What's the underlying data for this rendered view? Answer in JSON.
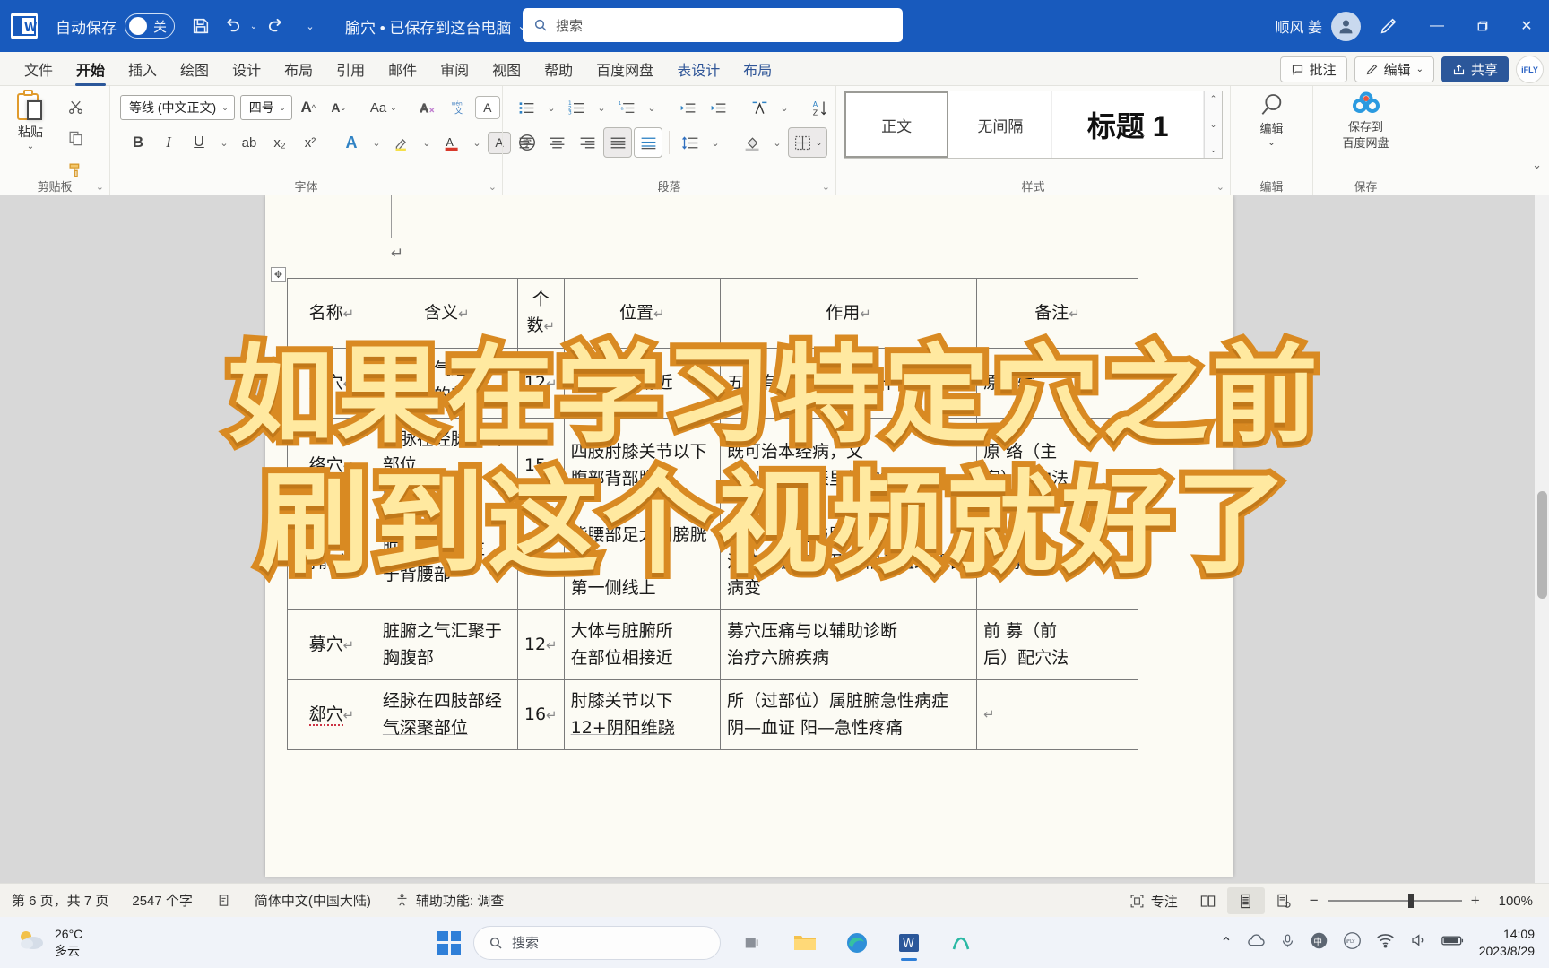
{
  "titlebar": {
    "app_icon": "word-icon",
    "autosave_label": "自动保存",
    "autosave_state": "关",
    "save_icon": "save-icon",
    "undo_icon": "undo-icon",
    "redo_icon": "redo-icon",
    "more_icon": "chevron-down-icon",
    "doc_title": "腧穴 • 已保存到这台电脑",
    "doc_title_caret": "⌄",
    "search_placeholder": "搜索",
    "search_icon": "search-icon",
    "user_name": "顺风 姜",
    "avatar_icon": "person-icon",
    "pen_icon": "pen-icon",
    "minimize": "—",
    "restore": "▢",
    "close": "✕",
    "bg_color": "#185abd"
  },
  "ribbon": {
    "tabs": [
      {
        "label": "文件",
        "state": "normal"
      },
      {
        "label": "开始",
        "state": "active"
      },
      {
        "label": "插入",
        "state": "normal"
      },
      {
        "label": "绘图",
        "state": "normal"
      },
      {
        "label": "设计",
        "state": "normal"
      },
      {
        "label": "布局",
        "state": "normal"
      },
      {
        "label": "引用",
        "state": "normal"
      },
      {
        "label": "邮件",
        "state": "normal"
      },
      {
        "label": "审阅",
        "state": "normal"
      },
      {
        "label": "视图",
        "state": "normal"
      },
      {
        "label": "帮助",
        "state": "normal"
      },
      {
        "label": "百度网盘",
        "state": "normal"
      },
      {
        "label": "表设计",
        "state": "contextual"
      },
      {
        "label": "布局",
        "state": "contextual"
      }
    ],
    "right_buttons": {
      "comment_label": "批注",
      "comment_icon": "comment-icon",
      "edit_label": "编辑",
      "edit_icon": "pencil-icon",
      "edit_caret": "⌄",
      "share_label": "共享",
      "share_icon": "share-icon",
      "ifly_label": "iFLY"
    },
    "groups": {
      "clipboard": {
        "label": "剪贴板",
        "paste_label": "粘贴",
        "paste_caret": "⌄",
        "cut_icon": "scissors-icon",
        "copy_icon": "copy-icon",
        "format_painter_icon": "format-painter-icon",
        "dialog_launcher": "⌄"
      },
      "font": {
        "label": "字体",
        "font_name": "等线 (中文正文)",
        "font_size": "四号",
        "grow_font_icon": "grow-font-icon",
        "shrink_font_icon": "shrink-font-icon",
        "change_case_label": "Aa",
        "clear_format_icon": "clear-formatting-icon",
        "phonetic_icon": "phonetic-guide-icon",
        "char_border_icon": "character-border-icon",
        "bold": "B",
        "italic": "I",
        "underline": "U",
        "strikethrough_icon": "strikethrough-icon",
        "subscript": "x₂",
        "superscript": "x²",
        "text_effects_icon": "text-effects-icon",
        "highlight_icon": "highlight-icon",
        "font_color_icon": "font-color-icon",
        "char_shading_icon": "character-shading-icon",
        "enclose_char_icon": "enclose-character-icon",
        "dialog_launcher": "⌄"
      },
      "paragraph": {
        "label": "段落",
        "bullets_icon": "bullet-list-icon",
        "numbering_icon": "numbered-list-icon",
        "multilevel_icon": "multilevel-list-icon",
        "decrease_indent_icon": "decrease-indent-icon",
        "increase_indent_icon": "increase-indent-icon",
        "cjk_layout_icon": "asian-layout-icon",
        "sort_icon": "sort-icon",
        "show_marks_icon": "show-formatting-marks-icon",
        "align_left_icon": "align-left-icon",
        "align_center_icon": "align-center-icon",
        "align_right_icon": "align-right-icon",
        "justify_icon": "justify-icon",
        "distribute_icon": "distribute-icon",
        "line_spacing_icon": "line-spacing-icon",
        "shading_icon": "shading-icon",
        "borders_icon": "borders-icon",
        "dialog_launcher": "⌄"
      },
      "styles": {
        "label": "样式",
        "items": [
          {
            "name": "正文",
            "selected": true
          },
          {
            "name": "无间隔",
            "selected": false
          },
          {
            "name": "标题 1",
            "selected": false
          }
        ],
        "scroll_up": "⌃",
        "scroll_down": "⌄",
        "more": "⌄",
        "dialog_launcher": "⌄"
      },
      "editing": {
        "label": "编辑",
        "find_icon": "search-icon",
        "editing_label": "编辑",
        "caret": "⌄"
      },
      "save": {
        "label": "保存",
        "baidu_label": "保存到\n百度网盘",
        "baidu_line1": "保存到",
        "baidu_line2": "百度网盘",
        "baidu_icon": "baidu-netdisk-icon"
      }
    },
    "collapse_icon": "⌄"
  },
  "document": {
    "table": {
      "headers": [
        "名称",
        "含义",
        "个\n数",
        "位置",
        "作用",
        "备注"
      ],
      "header_cells": [
        {
          "text": "名称",
          "mark": "↵"
        },
        {
          "text": "含义",
          "mark": "↵"
        },
        {
          "text": "个",
          "text2": "数",
          "mark": "↵"
        },
        {
          "text": "位置",
          "mark": "↵"
        },
        {
          "text": "作用",
          "mark": "↵"
        },
        {
          "text": "备注",
          "mark": "↵"
        }
      ],
      "rows": [
        {
          "name": "原穴",
          "meaning_l1": "脏腑原气经过",
          "meaning_l2": "和留止的部位",
          "count": "12",
          "location_l1": "腕踝关节附近",
          "location_l2": "",
          "effect_l1": "五脏有疾也，当取之十二原",
          "effect_l2": "",
          "note_l1": "原一输",
          "note_l2": ""
        },
        {
          "name": "络穴",
          "meaning_l1": "络脉在经脉分出部位",
          "meaning_l2": "的部位",
          "count": "15",
          "location_l1": "四肢肘膝关节以下",
          "location_l2": "腹部背部胸胁",
          "effect_l1": "既可治本经病，又",
          "effect_l2": "可以治疗相表里经的病症",
          "note_l1": "原 络（主",
          "note_l2": "客）配穴法"
        },
        {
          "name": "背俞穴",
          "meaning_l1": "脏腑之气输注",
          "meaning_l2": "于背腰部",
          "count": "12",
          "location_l1": "背腰部足太阳膀胱经",
          "location_l2": "第一侧线上",
          "effect_l1": "背俞穴压痛与脏腑病有关",
          "effect_l2": "治疗五脏疾病及其相关组织器官病变",
          "note_l1": "俞 募配穴法",
          "note_l2": ""
        },
        {
          "name": "募穴",
          "meaning_l1": "脏腑之气汇聚于",
          "meaning_l2": "胸腹部",
          "count": "12",
          "location_l1": "大体与脏腑所",
          "location_l2": "在部位相接近",
          "effect_l1": "募穴压痛与以辅助诊断",
          "effect_l2": "治疗六腑疾病",
          "note_l1": "前 募（前",
          "note_l2": "后）配穴法"
        },
        {
          "name": "郄穴",
          "meaning_l1": "经脉在四肢部经",
          "meaning_l2": "气深聚部位",
          "count": "16",
          "location_l1": "肘膝关节以下",
          "location_l2": "12+阴阳维跷",
          "effect_l1": "所（过部位）属脏腑急性病症",
          "effect_l2": "阴—血证        阳—急性疼痛",
          "note_l1": "",
          "note_l2": ""
        }
      ],
      "paragraph_mark": "↵"
    }
  },
  "overlay": {
    "line1": "如果在学习特定穴之前",
    "line2": "刷到这个视频就好了",
    "fill_color": "#ffe9a0",
    "stroke_color": "#d98a22"
  },
  "statusbar": {
    "page_info": "第 6 页，共 7 页",
    "word_count": "2547 个字",
    "proofing_icon": "proofing-icon",
    "language": "简体中文(中国大陆)",
    "accessibility_icon": "accessibility-icon",
    "accessibility": "辅助功能: 调查",
    "focus_icon": "focus-icon",
    "focus_label": "专注",
    "read_mode_icon": "read-mode-icon",
    "print_layout_icon": "print-layout-icon",
    "web_layout_icon": "web-layout-icon",
    "zoom_out": "−",
    "zoom_in": "+",
    "zoom_level": "100%"
  },
  "taskbar": {
    "weather_temp": "26°C",
    "weather_desc": "多云",
    "weather_icon": "cloudy-icon",
    "start_icon": "windows-start-icon",
    "search_placeholder": "搜索",
    "search_icon": "search-icon",
    "apps": [
      {
        "name": "task-view-icon",
        "glyph": "▣"
      },
      {
        "name": "file-explorer-icon",
        "glyph": "📁"
      },
      {
        "name": "edge-browser-icon",
        "glyph": "◉"
      },
      {
        "name": "word-app-icon",
        "glyph": "W"
      },
      {
        "name": "meeting-app-icon",
        "glyph": "M"
      }
    ],
    "tray": {
      "chevron_up_icon": "chevron-up-icon",
      "cloud_icon": "cloud-icon",
      "mic_icon": "microphone-icon",
      "ime_icon": "ime-icon",
      "ifly_icon": "ifly-icon",
      "wifi_icon": "wifi-icon",
      "volume_icon": "volume-icon",
      "battery_icon": "battery-icon",
      "time": "14:09",
      "date": "2023/8/29"
    }
  }
}
